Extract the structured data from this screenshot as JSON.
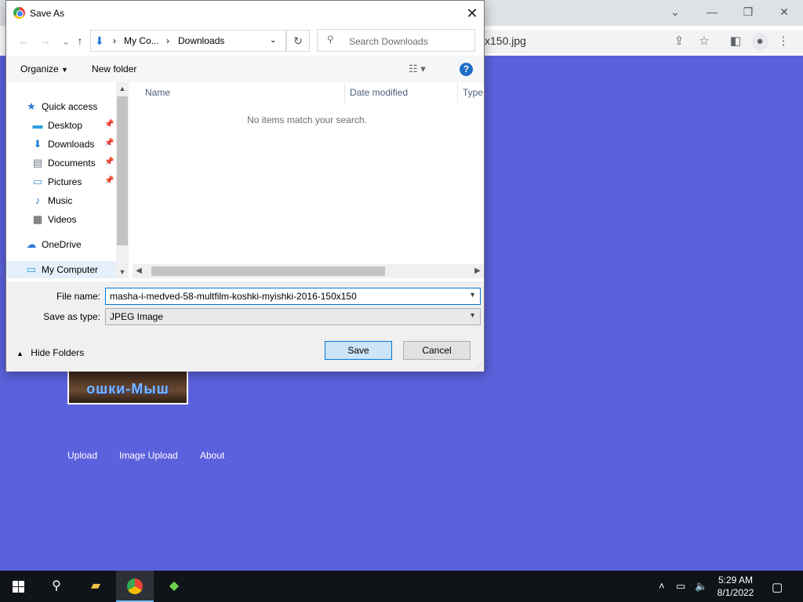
{
  "browser": {
    "omnibox_text": "x150.jpg",
    "controls": {
      "minimize": "—",
      "maximize": "❐",
      "close": "✕",
      "tab_list": "⌄"
    }
  },
  "page": {
    "thumbnail_caption": "ошки-Мыш",
    "links": [
      "Upload",
      "Image Upload",
      "About"
    ]
  },
  "dialog": {
    "title": "Save As",
    "breadcrumb": [
      "My Co...",
      "Downloads"
    ],
    "search_placeholder": "Search Downloads",
    "toolbar": {
      "organize": "Organize",
      "new_folder": "New folder"
    },
    "nav_items": [
      {
        "label": "Quick access",
        "icon": "star-icon",
        "glyph": "★",
        "color": "#2a7ad6",
        "indent": 1,
        "pinned": false
      },
      {
        "label": "Desktop",
        "icon": "desktop-icon",
        "glyph": "▬",
        "color": "#2a9de0",
        "indent": 2,
        "pinned": true
      },
      {
        "label": "Downloads",
        "icon": "download-icon",
        "glyph": "⬇",
        "color": "#2a7ad6",
        "indent": 2,
        "pinned": true
      },
      {
        "label": "Documents",
        "icon": "document-icon",
        "glyph": "▤",
        "color": "#6f7a88",
        "indent": 2,
        "pinned": true
      },
      {
        "label": "Pictures",
        "icon": "picture-icon",
        "glyph": "▭",
        "color": "#4a8fcf",
        "indent": 2,
        "pinned": true
      },
      {
        "label": "Music",
        "icon": "music-icon",
        "glyph": "♪",
        "color": "#2a7ad6",
        "indent": 2,
        "pinned": false
      },
      {
        "label": "Videos",
        "icon": "video-icon",
        "glyph": "▦",
        "color": "#444444",
        "indent": 2,
        "pinned": false
      },
      {
        "label": "OneDrive",
        "icon": "cloud-icon",
        "glyph": "☁",
        "color": "#2a7ad6",
        "indent": 1,
        "pinned": false
      },
      {
        "label": "My Computer",
        "icon": "computer-icon",
        "glyph": "▭",
        "color": "#2a9de0",
        "indent": 1,
        "pinned": false,
        "selected": true
      }
    ],
    "columns": [
      "Name",
      "Date modified",
      "Type"
    ],
    "empty_message": "No items match your search.",
    "file_name_label": "File name:",
    "file_name_value": "masha-i-medved-58-multfilm-koshki-myishki-2016-150x150",
    "save_type_label": "Save as type:",
    "save_type_value": "JPEG Image",
    "hide_folders": "Hide Folders",
    "save_button": "Save",
    "cancel_button": "Cancel"
  },
  "taskbar": {
    "time": "5:29 AM",
    "date": "8/1/2022"
  },
  "colors": {
    "page_background": "#5b61dc",
    "accent": "#0078d7"
  }
}
